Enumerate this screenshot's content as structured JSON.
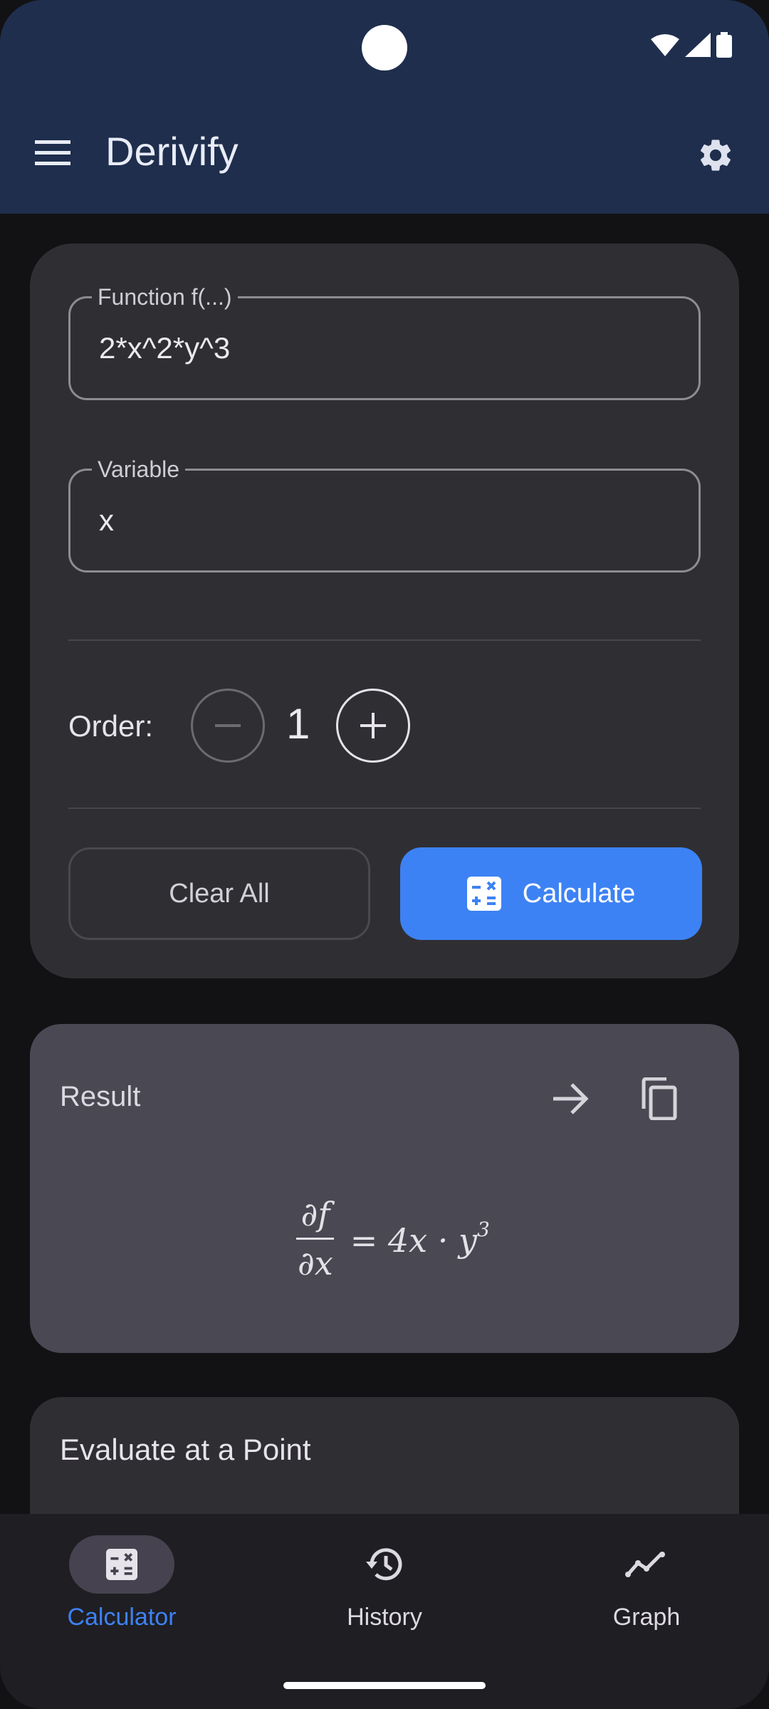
{
  "app": {
    "title": "Derivify"
  },
  "colors": {
    "appbar": "#1f2e4d",
    "accent": "#3d82f4",
    "card": "#2f2f33",
    "result_card": "#4a4853"
  },
  "icons": {
    "menu": "hamburger-menu-icon",
    "settings": "gear-icon",
    "wifi": "wifi-icon",
    "signal": "cellular-signal-icon",
    "battery": "battery-icon"
  },
  "inputs": {
    "function": {
      "label": "Function f(...)",
      "value": "2*x^2*y^3"
    },
    "variable": {
      "label": "Variable",
      "value": "x"
    }
  },
  "order": {
    "label": "Order:",
    "value": "1"
  },
  "actions": {
    "clear_label": "Clear All",
    "calculate_label": "Calculate"
  },
  "result": {
    "title": "Result",
    "formula": {
      "numerator": "∂f",
      "denominator": "∂x",
      "rhs": "= 4x · y",
      "exponent": "3"
    }
  },
  "evaluate": {
    "title": "Evaluate at a Point"
  },
  "nav": {
    "items": [
      {
        "label": "Calculator",
        "active": true
      },
      {
        "label": "History",
        "active": false
      },
      {
        "label": "Graph",
        "active": false
      }
    ]
  }
}
